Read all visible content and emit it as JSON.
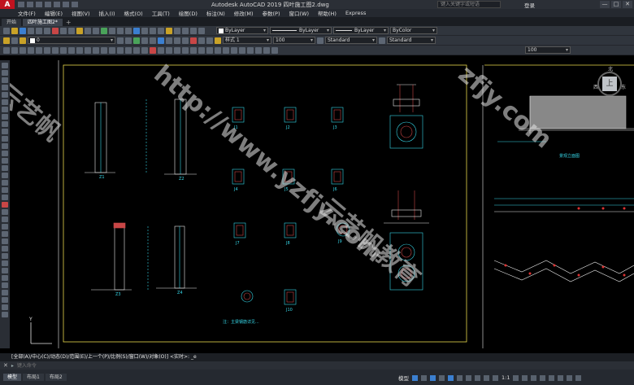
{
  "app": {
    "title": "Autodesk AutoCAD 2019    四叶施工图2.dwg",
    "logo": "A",
    "search_placeholder": "键入关键字或短语",
    "login_label": "登录",
    "window_buttons": [
      "—",
      "□",
      "✕"
    ]
  },
  "menu": {
    "items": [
      "文件(F)",
      "编辑(E)",
      "视图(V)",
      "插入(I)",
      "格式(O)",
      "工具(T)",
      "绘图(D)",
      "标注(N)",
      "修改(M)",
      "参数(P)",
      "窗口(W)",
      "帮助(H)",
      "Express"
    ]
  },
  "doc_tabs": {
    "items": [
      "开始",
      "四叶施工图2*"
    ],
    "plus": "+"
  },
  "toolbar": {
    "layer_value": "0",
    "color_value": "ByLayer",
    "linetype_value": "ByLayer",
    "lineweight_value": "ByLayer",
    "plotstyle_value": "ByColor",
    "text_style": "样式 1",
    "text_height": "100",
    "dim_style": "Standard",
    "table_style": "Standard",
    "scale_value": "100"
  },
  "drawing": {
    "labels": [
      "Z1",
      "Z2",
      "Z3",
      "Z4",
      "J1",
      "J2",
      "J3",
      "J4",
      "J5",
      "J6",
      "J7",
      "J8",
      "J9",
      "J10"
    ],
    "notes": {
      "note1": "注：主梁钢筋详见...",
      "section_title_right": "景观立面图",
      "compass_n": "北",
      "compass_w": "西",
      "compass_e": "东",
      "cube_face": "上"
    }
  },
  "watermarks": [
    "http://www.yzfjy.com",
    "云艺帆教育",
    "zfjy.com",
    "云艺帆"
  ],
  "command": {
    "history": "[全部(A)/中心(C)/动态(D)/范围(E)/上一个(P)/比例(S)/窗口(W)/对象(O)] <实时>: _e",
    "prompt_icon": "✕",
    "input_placeholder": "键入命令"
  },
  "layout_tabs": [
    "模型",
    "布局1",
    "布局2"
  ],
  "status": {
    "model_label": "模型",
    "scale_label": "1:1"
  }
}
